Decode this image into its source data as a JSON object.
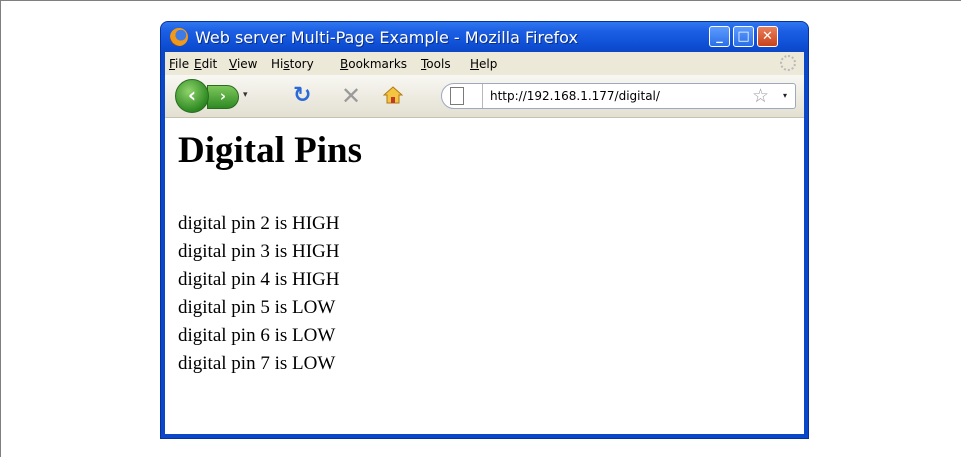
{
  "window": {
    "title": "Web server Multi-Page Example - Mozilla Firefox",
    "minimize_symbol": "_",
    "maximize_symbol": "□",
    "close_symbol": "✕"
  },
  "menu": {
    "items": [
      {
        "label": "File",
        "key": "F",
        "rest": "ile"
      },
      {
        "label": "Edit",
        "key": "E",
        "rest": "dit"
      },
      {
        "label": "View",
        "key": "V",
        "rest": "iew"
      },
      {
        "label": "History",
        "key": "s",
        "pre": "Hi",
        "rest": "tory"
      },
      {
        "label": "Bookmarks",
        "key": "B",
        "rest": "ookmarks"
      },
      {
        "label": "Tools",
        "key": "T",
        "rest": "ools"
      },
      {
        "label": "Help",
        "key": "H",
        "rest": "elp"
      }
    ]
  },
  "navbar": {
    "back_symbol": "‹",
    "forward_symbol": "›",
    "dropdown_symbol": "▾",
    "reload_symbol": "↻",
    "stop_symbol": "✕",
    "url": "http://192.168.1.177/digital/",
    "star_symbol": "☆"
  },
  "page": {
    "heading": "Digital Pins",
    "pins": [
      "digital pin 2 is HIGH",
      "digital pin 3 is HIGH",
      "digital pin 4 is HIGH",
      "digital pin 5 is LOW",
      "digital pin 6 is LOW",
      "digital pin 7 is LOW"
    ]
  },
  "colors": {
    "titlebar": "#0f51d8",
    "window_border": "#0a47c9",
    "menubar": "#ece9d8",
    "close_button": "#c9421b",
    "nav_green": "#2f8a23"
  },
  "icons": [
    "firefox-logo-icon",
    "back-icon",
    "forward-icon",
    "reload-icon",
    "stop-icon",
    "home-icon",
    "page-icon",
    "star-icon",
    "throbber-icon"
  ]
}
